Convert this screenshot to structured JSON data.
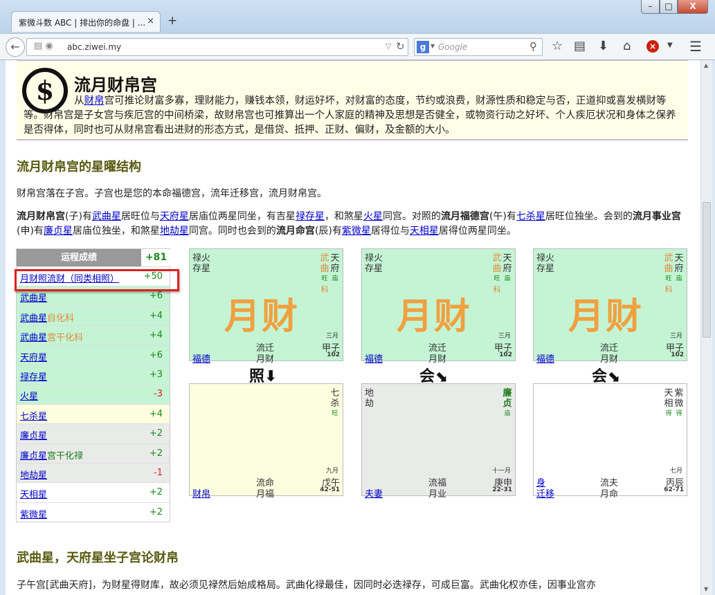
{
  "browser": {
    "tab_title": "紫微斗数 ABC | 排出你的命盘 | ...",
    "tab_close": "×",
    "new_tab": "+",
    "url": "abc.ziwei.my",
    "search_engine": "g",
    "search_placeholder": "Google",
    "win_min": "–",
    "win_max": "□",
    "win_close": "X"
  },
  "intro": {
    "title": "流月财帛宫",
    "text_pre": "从",
    "text_link": "财帛",
    "text_post": "宫可推论财富多寡，理财能力，赚钱本领，财运好坏，对财富的态度，节约或浪费，财源性质和稳定与否，正道抑或喜发横财等等。财帛宫是子女宫与疾厄宫的中间桥梁，故财帛宫也可推算出一个人家庭的精神及思想是否健全，或物资行动之好坏、个人疾厄状况和身体之保养是否得体，同时也可从财帛宫看出进财的形态方式，是借贷、抵押、正财、偏财，及金额的大小。"
  },
  "section1": {
    "heading": "流月财帛宫的星曜结构",
    "p1": "财帛宫落在子宫。子宫也是您的本命福德宫，流年迁移宫，流月财帛宫。",
    "p2": {
      "a": "流月财帛宫",
      "b": "(子)有",
      "l1": "武曲星",
      "c": "居旺位与",
      "l2": "天府星",
      "d": "居庙位两星同坐，有吉星",
      "l3": "禄存星",
      "e": "，和煞星",
      "l4": "火星",
      "f": "同宫。对照的",
      "g": "流月福德宫",
      "h": "(午)有",
      "l5": "七杀星",
      "i": "居旺位独坐。会到的",
      "j": "流月事业宫",
      "k": "(申)有",
      "l6": "廉贞星",
      "m": "居庙位独坐，和煞星",
      "l7": "地劫星",
      "n": "同宫。同时也会到的",
      "o": "流月命宫",
      "p": "(辰)有",
      "l8": "紫微星",
      "q": "居得位与",
      "l9": "天相星",
      "r": "居得位两星同坐。"
    }
  },
  "score": {
    "header_label": "运程成绩",
    "header_value": "+81",
    "rows": [
      {
        "label": "月财照流财（同类相照）",
        "sub": "",
        "value": "+50"
      },
      {
        "label": "武曲星",
        "sub": "",
        "value": "+6"
      },
      {
        "label": "武曲星",
        "sub": "自化科",
        "value": "+4"
      },
      {
        "label": "武曲星",
        "sub": "宫干化科",
        "value": "+4"
      },
      {
        "label": "天府星",
        "sub": "",
        "value": "+6"
      },
      {
        "label": "禄存星",
        "sub": "",
        "value": "+3"
      },
      {
        "label": "火星",
        "sub": "",
        "value": "-3"
      },
      {
        "label": "七杀星",
        "sub": "",
        "value": "+4"
      },
      {
        "label": "廉贞星",
        "sub": "",
        "value": "+2"
      },
      {
        "label": "廉贞星",
        "sub": "宫干化禄",
        "value": "+2"
      },
      {
        "label": "地劫星",
        "sub": "",
        "value": "-1"
      },
      {
        "label": "天相星",
        "sub": "",
        "value": "+2"
      },
      {
        "label": "紫微星",
        "sub": "",
        "value": "+2"
      }
    ]
  },
  "palaces": {
    "top": {
      "minor": [
        "禄火",
        "存星"
      ],
      "major": [
        "武",
        "曲",
        "天",
        "府"
      ],
      "bright": [
        "旺",
        "庙"
      ],
      "hua": "科",
      "big": "月财",
      "month": "三月",
      "ganzhi": "甲子",
      "age": "102",
      "line1": "流迁",
      "line2": "月财",
      "name": "福德"
    },
    "bottom1": {
      "major": [
        "七",
        "杀"
      ],
      "bright": "旺",
      "month": "九月",
      "ganzhi": "戊午",
      "age": "42-51",
      "line1": "流命",
      "line2": "月福",
      "name": "财帛"
    },
    "bottom2": {
      "minor": [
        "地",
        "劫"
      ],
      "major": [
        "廉",
        "贞"
      ],
      "bright": "庙",
      "month": "十一月",
      "ganzhi": "庚申",
      "age": "22-31",
      "line1": "流福",
      "line2": "月业",
      "name": "夫妻"
    },
    "bottom3": {
      "major": [
        "天",
        "相",
        "紫",
        "微"
      ],
      "bright": [
        "得",
        "得"
      ],
      "month": "七月",
      "ganzhi": "丙辰",
      "age": "62-71",
      "line1": "流夫",
      "line2": "月命",
      "name1": "身",
      "name2": "迁移"
    },
    "arrow1": "照⬇",
    "arrow2": "会⬊",
    "arrow3": "会⬊"
  },
  "section2": {
    "heading": "武曲星，天府星坐子宫论财帛",
    "p3": "子午宫[武曲天府]，为财星得财库，故必须见禄然后始成格局。武曲化禄最佳，因同时必迭禄存，可成巨富。武曲化权亦佳，因事业宫亦"
  }
}
